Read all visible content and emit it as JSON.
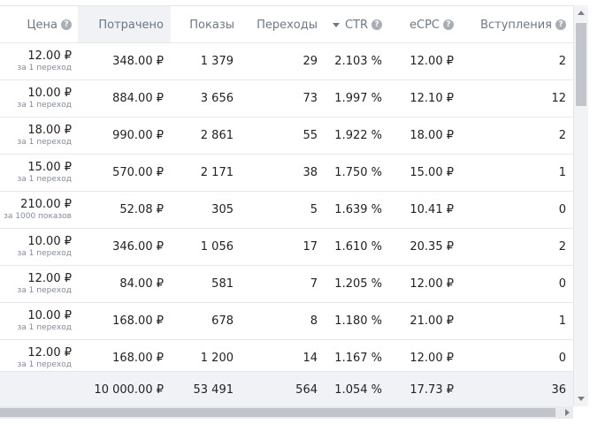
{
  "header": {
    "price": "Цена",
    "spent": "Потрачено",
    "impressions": "Показы",
    "clicks": "Переходы",
    "ctr": "CTR",
    "ecpc": "eCPC",
    "joins": "Вступления"
  },
  "rows": [
    {
      "price": "12.00 ₽",
      "price_unit": "за 1 переход",
      "spent": "348.00 ₽",
      "impressions": "1 379",
      "clicks": "29",
      "ctr": "2.103 %",
      "ecpc": "12.00 ₽",
      "joins": "2"
    },
    {
      "price": "10.00 ₽",
      "price_unit": "за 1 переход",
      "spent": "884.00 ₽",
      "impressions": "3 656",
      "clicks": "73",
      "ctr": "1.997 %",
      "ecpc": "12.10 ₽",
      "joins": "12"
    },
    {
      "price": "18.00 ₽",
      "price_unit": "за 1 переход",
      "spent": "990.00 ₽",
      "impressions": "2 861",
      "clicks": "55",
      "ctr": "1.922 %",
      "ecpc": "18.00 ₽",
      "joins": "2"
    },
    {
      "price": "15.00 ₽",
      "price_unit": "за 1 переход",
      "spent": "570.00 ₽",
      "impressions": "2 171",
      "clicks": "38",
      "ctr": "1.750 %",
      "ecpc": "15.00 ₽",
      "joins": "1"
    },
    {
      "price": "210.00 ₽",
      "price_unit": "за 1000 показов",
      "spent": "52.08 ₽",
      "impressions": "305",
      "clicks": "5",
      "ctr": "1.639 %",
      "ecpc": "10.41 ₽",
      "joins": "0"
    },
    {
      "price": "10.00 ₽",
      "price_unit": "за 1 переход",
      "spent": "346.00 ₽",
      "impressions": "1 056",
      "clicks": "17",
      "ctr": "1.610 %",
      "ecpc": "20.35 ₽",
      "joins": "2"
    },
    {
      "price": "12.00 ₽",
      "price_unit": "за 1 переход",
      "spent": "84.00 ₽",
      "impressions": "581",
      "clicks": "7",
      "ctr": "1.205 %",
      "ecpc": "12.00 ₽",
      "joins": "0"
    },
    {
      "price": "10.00 ₽",
      "price_unit": "за 1 переход",
      "spent": "168.00 ₽",
      "impressions": "678",
      "clicks": "8",
      "ctr": "1.180 %",
      "ecpc": "21.00 ₽",
      "joins": "1"
    },
    {
      "price": "12.00 ₽",
      "price_unit": "за 1 переход",
      "spent": "168.00 ₽",
      "impressions": "1 200",
      "clicks": "14",
      "ctr": "1.167 %",
      "ecpc": "12.00 ₽",
      "joins": "0"
    }
  ],
  "totals": {
    "spent": "10 000.00 ₽",
    "impressions": "53 491",
    "clicks": "564",
    "ctr": "1.054 %",
    "ecpc": "17.73 ₽",
    "joins": "36"
  },
  "icons": {
    "help": "?",
    "sort": "sort-desc-icon"
  },
  "colors": {
    "header_text": "#6d7885",
    "active_column_bg": "#f0f2f5",
    "help_icon_bg": "#a8aeb6"
  }
}
